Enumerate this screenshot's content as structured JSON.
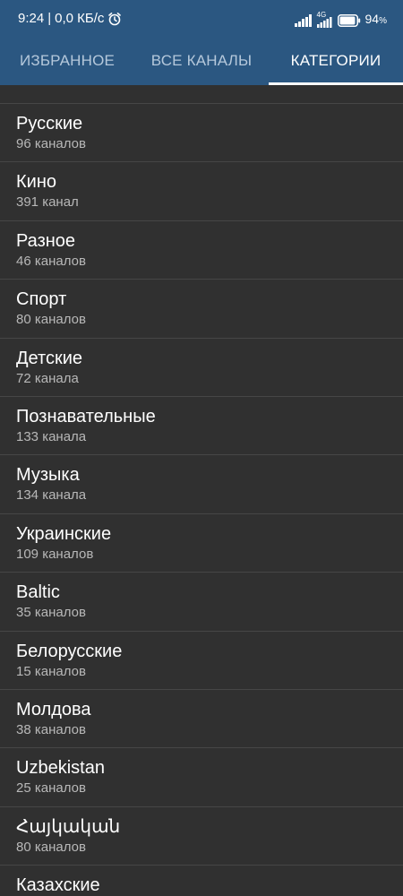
{
  "status_bar": {
    "time": "9:24",
    "separator": "|",
    "speed": "0,0 КБ/с",
    "network_type": "4G",
    "battery_value": "94",
    "battery_unit": "%",
    "battery_level": 0.94,
    "icons": [
      "alarm-icon",
      "signal-icon",
      "network-4g-icon",
      "battery-icon"
    ]
  },
  "tabs": [
    {
      "label": "ИЗБРАННОЕ",
      "active": false
    },
    {
      "label": "ВСЕ КАНАЛЫ",
      "active": false
    },
    {
      "label": "КАТЕГОРИИ",
      "active": true
    }
  ],
  "categories": [
    {
      "name": "Русские",
      "count": "96 каналов"
    },
    {
      "name": "Кино",
      "count": "391 канал"
    },
    {
      "name": "Разное",
      "count": "46 каналов"
    },
    {
      "name": "Спорт",
      "count": "80 каналов"
    },
    {
      "name": "Детские",
      "count": "72 канала"
    },
    {
      "name": "Познавательные",
      "count": "133 канала"
    },
    {
      "name": "Музыка",
      "count": "134 канала"
    },
    {
      "name": "Украинские",
      "count": "109 каналов"
    },
    {
      "name": "Baltic",
      "count": "35 каналов"
    },
    {
      "name": "Белорусские",
      "count": "15 каналов"
    },
    {
      "name": "Молдова",
      "count": "38 каналов"
    },
    {
      "name": "Uzbekistan",
      "count": "25 каналов"
    },
    {
      "name": "Հայկական",
      "count": "80 каналов"
    },
    {
      "name": "Казахские",
      "count": ""
    }
  ],
  "colors": {
    "header_bg": "#2b5781",
    "list_bg": "#303030",
    "divider": "#464646",
    "active_tab": "#ffffff",
    "inactive_tab": "#b5c8db",
    "title_text": "#ffffff",
    "count_text": "#b8b8b8"
  }
}
